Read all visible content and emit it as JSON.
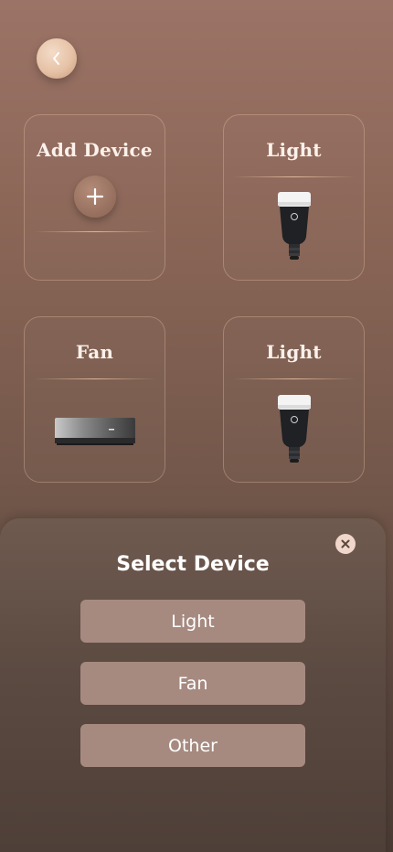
{
  "header": {
    "back_icon": "chevron-left-icon"
  },
  "devices": [
    {
      "title": "Add Device",
      "icon": "plus-icon"
    },
    {
      "title": "Light",
      "icon": "light-bulb-icon"
    },
    {
      "title": "Fan",
      "icon": "air-conditioner-icon"
    },
    {
      "title": "Light",
      "icon": "light-bulb-icon"
    }
  ],
  "sheet": {
    "title": "Select Device",
    "close_icon": "close-icon",
    "options": [
      "Light",
      "Fan",
      "Other"
    ]
  },
  "colors": {
    "accent": "#e6c2a6",
    "option_bg": "#a68a80",
    "sheet_bg": "#5b4a41"
  }
}
